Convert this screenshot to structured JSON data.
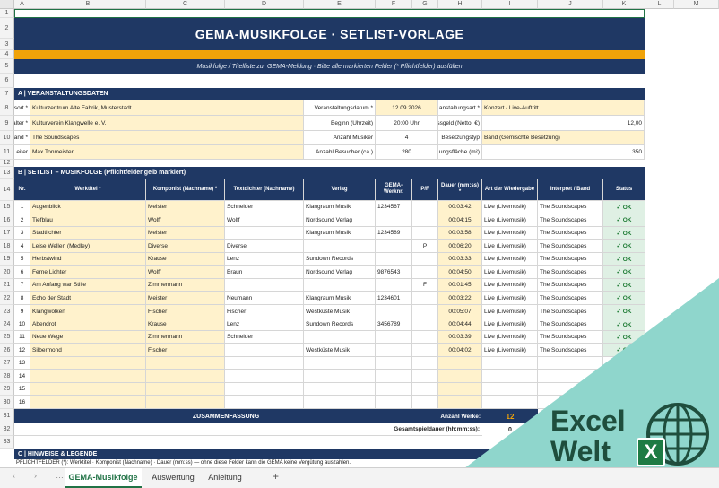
{
  "columns": [
    "A",
    "B",
    "C",
    "D",
    "E",
    "F",
    "G",
    "H",
    "I",
    "J",
    "K",
    "L",
    "M"
  ],
  "rows": [
    "1",
    "2",
    "3",
    "4",
    "5",
    "6",
    "7",
    "8",
    "9",
    "10",
    "11",
    "12",
    "13",
    "14",
    "15",
    "16",
    "17",
    "18",
    "19",
    "20",
    "21",
    "22",
    "23",
    "24",
    "25",
    "26",
    "27",
    "28",
    "29",
    "30",
    "31",
    "32",
    "33"
  ],
  "title": "GEMA-MUSIKFOLGE · SETLIST-VORLAGE",
  "subtitle": "Musikfolge / Titelliste zur GEMA-Meldung · Bitte alle markierten Felder (* Pflichtfelder) ausfüllen",
  "section_a": {
    "header": "A | VERANSTALTUNGSDATEN",
    "left": [
      {
        "label": "sort *",
        "value": "Kulturzentrum Alte Fabrik, Musterstadt"
      },
      {
        "label": "alter *",
        "value": "Kulturverein Klangwelle e. V."
      },
      {
        "label": "Band *",
        "value": "The Soundscapes"
      },
      {
        "label": "Leiter",
        "value": "Max Tonmeister"
      }
    ],
    "mid": [
      {
        "label": "Veranstaltungsdatum *",
        "value": "12.09.2026"
      },
      {
        "label": "Beginn (Uhrzeit)",
        "value": "20:00 Uhr"
      },
      {
        "label": "Anzahl Musiker",
        "value": "4"
      },
      {
        "label": "Anzahl Besucher (ca.)",
        "value": "280"
      }
    ],
    "right": [
      {
        "label": "anstaltungsart *",
        "value": "Konzert / Live-Auftritt"
      },
      {
        "label": "ssgeld (Netto, €)",
        "value": "12,00"
      },
      {
        "label": "Besetzungstyp",
        "value": "Band (Gemischte Besetzung)"
      },
      {
        "label": "ungsfläche (m²)",
        "value": "350"
      }
    ]
  },
  "section_b": {
    "header": "B | SETLIST – MUSIKFOLGE (Pflichtfelder gelb markiert)",
    "headers": [
      "Nr.",
      "Werktitel *",
      "Komponist (Nachname) *",
      "Textdichter (Nachname)",
      "Verlag",
      "GEMA-Werknr.",
      "P/F",
      "Dauer (mm:ss) *",
      "Art der Wiedergabe",
      "Interpret / Band",
      "Status"
    ],
    "rows": [
      {
        "nr": "1",
        "titel": "Augenblick",
        "komponist": "Meister",
        "text": "Schneider",
        "verlag": "Klangraum Musik",
        "werknr": "1234567",
        "pf": "",
        "dauer": "00:03:42",
        "art": "Live (Livemusik)",
        "interpret": "The Soundscapes",
        "status": "✓ OK"
      },
      {
        "nr": "2",
        "titel": "Tiefblau",
        "komponist": "Wolff",
        "text": "Wolff",
        "verlag": "Nordsound Verlag",
        "werknr": "",
        "pf": "",
        "dauer": "00:04:15",
        "art": "Live (Livemusik)",
        "interpret": "The Soundscapes",
        "status": "✓ OK"
      },
      {
        "nr": "3",
        "titel": "Stadtlichter",
        "komponist": "Meister",
        "text": "",
        "verlag": "Klangraum Musik",
        "werknr": "1234589",
        "pf": "",
        "dauer": "00:03:58",
        "art": "Live (Livemusik)",
        "interpret": "The Soundscapes",
        "status": "✓ OK"
      },
      {
        "nr": "4",
        "titel": "Leise Wellen (Medley)",
        "komponist": "Diverse",
        "text": "Diverse",
        "verlag": "",
        "werknr": "",
        "pf": "P",
        "dauer": "00:06:20",
        "art": "Live (Livemusik)",
        "interpret": "The Soundscapes",
        "status": "✓ OK"
      },
      {
        "nr": "5",
        "titel": "Herbstwind",
        "komponist": "Krause",
        "text": "Lenz",
        "verlag": "Sundown Records",
        "werknr": "",
        "pf": "",
        "dauer": "00:03:33",
        "art": "Live (Livemusik)",
        "interpret": "The Soundscapes",
        "status": "✓ OK"
      },
      {
        "nr": "6",
        "titel": "Ferne Lichter",
        "komponist": "Wolff",
        "text": "Braun",
        "verlag": "Nordsound Verlag",
        "werknr": "9876543",
        "pf": "",
        "dauer": "00:04:50",
        "art": "Live (Livemusik)",
        "interpret": "The Soundscapes",
        "status": "✓ OK"
      },
      {
        "nr": "7",
        "titel": "Am Anfang war Stille",
        "komponist": "Zimmermann",
        "text": "",
        "verlag": "",
        "werknr": "",
        "pf": "F",
        "dauer": "00:01:45",
        "art": "Live (Livemusik)",
        "interpret": "The Soundscapes",
        "status": "✓ OK"
      },
      {
        "nr": "8",
        "titel": "Echo der Stadt",
        "komponist": "Meister",
        "text": "Neumann",
        "verlag": "Klangraum Musik",
        "werknr": "1234601",
        "pf": "",
        "dauer": "00:03:22",
        "art": "Live (Livemusik)",
        "interpret": "The Soundscapes",
        "status": "✓ OK"
      },
      {
        "nr": "9",
        "titel": "Klangwolken",
        "komponist": "Fischer",
        "text": "Fischer",
        "verlag": "Westküste Musik",
        "werknr": "",
        "pf": "",
        "dauer": "00:05:07",
        "art": "Live (Livemusik)",
        "interpret": "The Soundscapes",
        "status": "✓ OK"
      },
      {
        "nr": "10",
        "titel": "Abendrot",
        "komponist": "Krause",
        "text": "Lenz",
        "verlag": "Sundown Records",
        "werknr": "3456789",
        "pf": "",
        "dauer": "00:04:44",
        "art": "Live (Livemusik)",
        "interpret": "The Soundscapes",
        "status": "✓ OK"
      },
      {
        "nr": "11",
        "titel": "Neue Wege",
        "komponist": "Zimmermann",
        "text": "Schneider",
        "verlag": "",
        "werknr": "",
        "pf": "",
        "dauer": "00:03:39",
        "art": "Live (Livemusik)",
        "interpret": "The Soundscapes",
        "status": "✓ OK"
      },
      {
        "nr": "12",
        "titel": "Silbermond",
        "komponist": "Fischer",
        "text": "",
        "verlag": "Westküste Musik",
        "werknr": "",
        "pf": "",
        "dauer": "00:04:02",
        "art": "Live (Livemusik)",
        "interpret": "The Soundscapes",
        "status": "✓ OK"
      },
      {
        "nr": "13",
        "titel": "",
        "komponist": "",
        "text": "",
        "verlag": "",
        "werknr": "",
        "pf": "",
        "dauer": "",
        "art": "",
        "interpret": "",
        "status": ""
      },
      {
        "nr": "14",
        "titel": "",
        "komponist": "",
        "text": "",
        "verlag": "",
        "werknr": "",
        "pf": "",
        "dauer": "",
        "art": "",
        "interpret": "",
        "status": ""
      },
      {
        "nr": "15",
        "titel": "",
        "komponist": "",
        "text": "",
        "verlag": "",
        "werknr": "",
        "pf": "",
        "dauer": "",
        "art": "",
        "interpret": "",
        "status": ""
      },
      {
        "nr": "16",
        "titel": "",
        "komponist": "",
        "text": "",
        "verlag": "",
        "werknr": "",
        "pf": "",
        "dauer": "",
        "art": "",
        "interpret": "",
        "status": ""
      }
    ],
    "summary_title": "ZUSAMMENFASSUNG",
    "anzahl_label": "Anzahl Werke:",
    "anzahl_value": "12",
    "gesamt_label": "Gesamtspieldauer (hh:mm:ss):",
    "gesamt_value": "0"
  },
  "section_c": {
    "header": "C | HINWEISE & LEGENDE",
    "note": "PFLICHTFELDER (*): Werktitel · Komponist (Nachname) · Dauer (mm:ss) — ohne diese Felder kann die GEMA keine Vergütung auszahlen."
  },
  "tabs": [
    "GEMA-Musikfolge",
    "Auswertung",
    "Anleitung"
  ],
  "logo": {
    "line1": "Excel",
    "line2": "Welt",
    "badge": "X"
  },
  "colors": {
    "navy": "#1f3864",
    "gold": "#f0a30a",
    "yellow": "#fff2cc",
    "teal": "#8fd6cc",
    "green": "#1e7b34",
    "logo_dark": "#1f4e3d"
  }
}
